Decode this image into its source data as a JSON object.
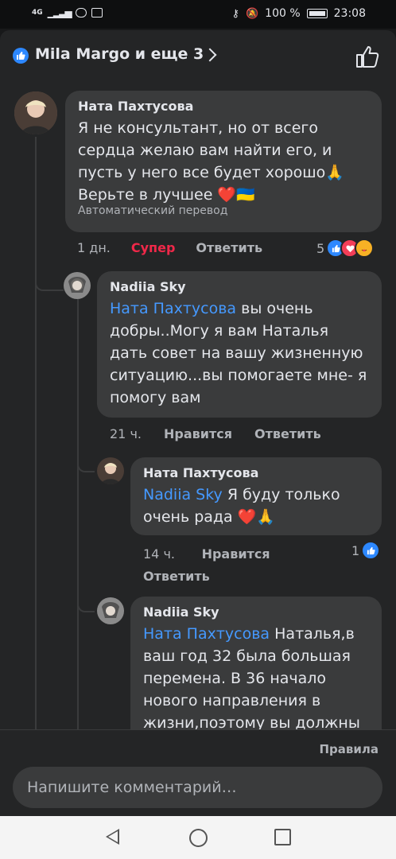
{
  "status_bar": {
    "network": "4G",
    "battery_percent": "100 %",
    "time": "23:08"
  },
  "header": {
    "title": "Mila Margo и еще 3"
  },
  "comments": [
    {
      "author": "Ната Пахтусова",
      "text": "Я не консультант, но от всего сердца желаю вам найти его, и пусть у него все будет хорошо🙏 Верьте в лучшее ❤️🇺🇦",
      "translation_note": "Автоматический перевод",
      "time": "1 дн.",
      "reaction_label": "Супер",
      "reply_label": "Ответить",
      "reaction_count": "5"
    },
    {
      "author": "Nadiia Sky",
      "mention": "Ната Пахтусова",
      "text": " вы очень добры..Могу я вам Наталья дать совет на вашу жизненную ситуацию...вы помогаете мне- я помогу вам",
      "time": "21 ч.",
      "like_label": "Нравится",
      "reply_label": "Ответить"
    },
    {
      "author": "Ната Пахтусова",
      "mention": "Nadiia Sky",
      "text": " Я буду только очень рада ❤️🙏",
      "time": "14 ч.",
      "like_label": "Нравится",
      "reply_label": "Ответить",
      "reaction_count": "1"
    },
    {
      "author": "Nadiia Sky",
      "mention": "Ната Пахтусова",
      "text": " Наталья,в ваш год 32 была большая перемена. В 36 начало нового направления в жизни,поэтому вы должны"
    }
  ],
  "footer": {
    "rules_label": "Правила",
    "comment_placeholder": "Напишите комментарий…"
  },
  "colors": {
    "background": "#242526",
    "bubble": "#3a3b3c",
    "mention": "#4599ff",
    "super_reaction": "#f02849",
    "like_blue": "#2d88ff"
  }
}
